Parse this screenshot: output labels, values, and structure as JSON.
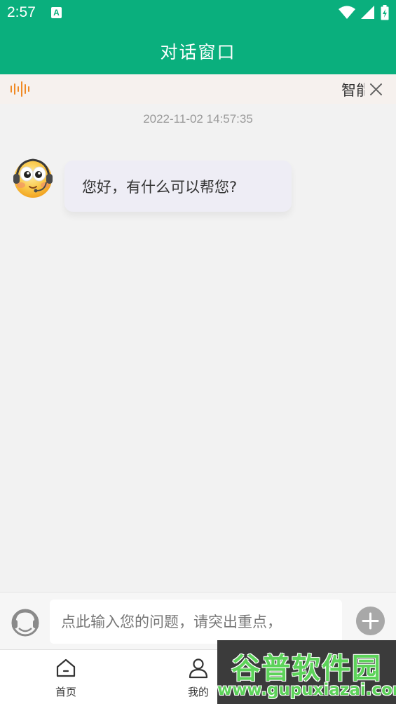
{
  "status_bar": {
    "time": "2:57",
    "notification_icon_letter": "A"
  },
  "header": {
    "title": "对话窗口"
  },
  "notice": {
    "text": "智能",
    "icon": "sound-wave-icon",
    "close_icon": "close-icon"
  },
  "chat": {
    "timestamp": "2022-11-02 14:57:35",
    "messages": [
      {
        "sender": "bot",
        "text": "您好，有什么可以帮您?"
      }
    ]
  },
  "input": {
    "placeholder": "点此输入您的问题，请突出重点，"
  },
  "tabs": [
    {
      "label": "首页",
      "icon": "home-icon"
    },
    {
      "label": "我的",
      "icon": "user-icon"
    }
  ],
  "watermark": {
    "title": "谷普软件园",
    "url": "www.gupuxiazai.com"
  },
  "colors": {
    "brand": "#0aaf7d",
    "accent": "#f08a24",
    "bubble": "#eeedf5"
  }
}
